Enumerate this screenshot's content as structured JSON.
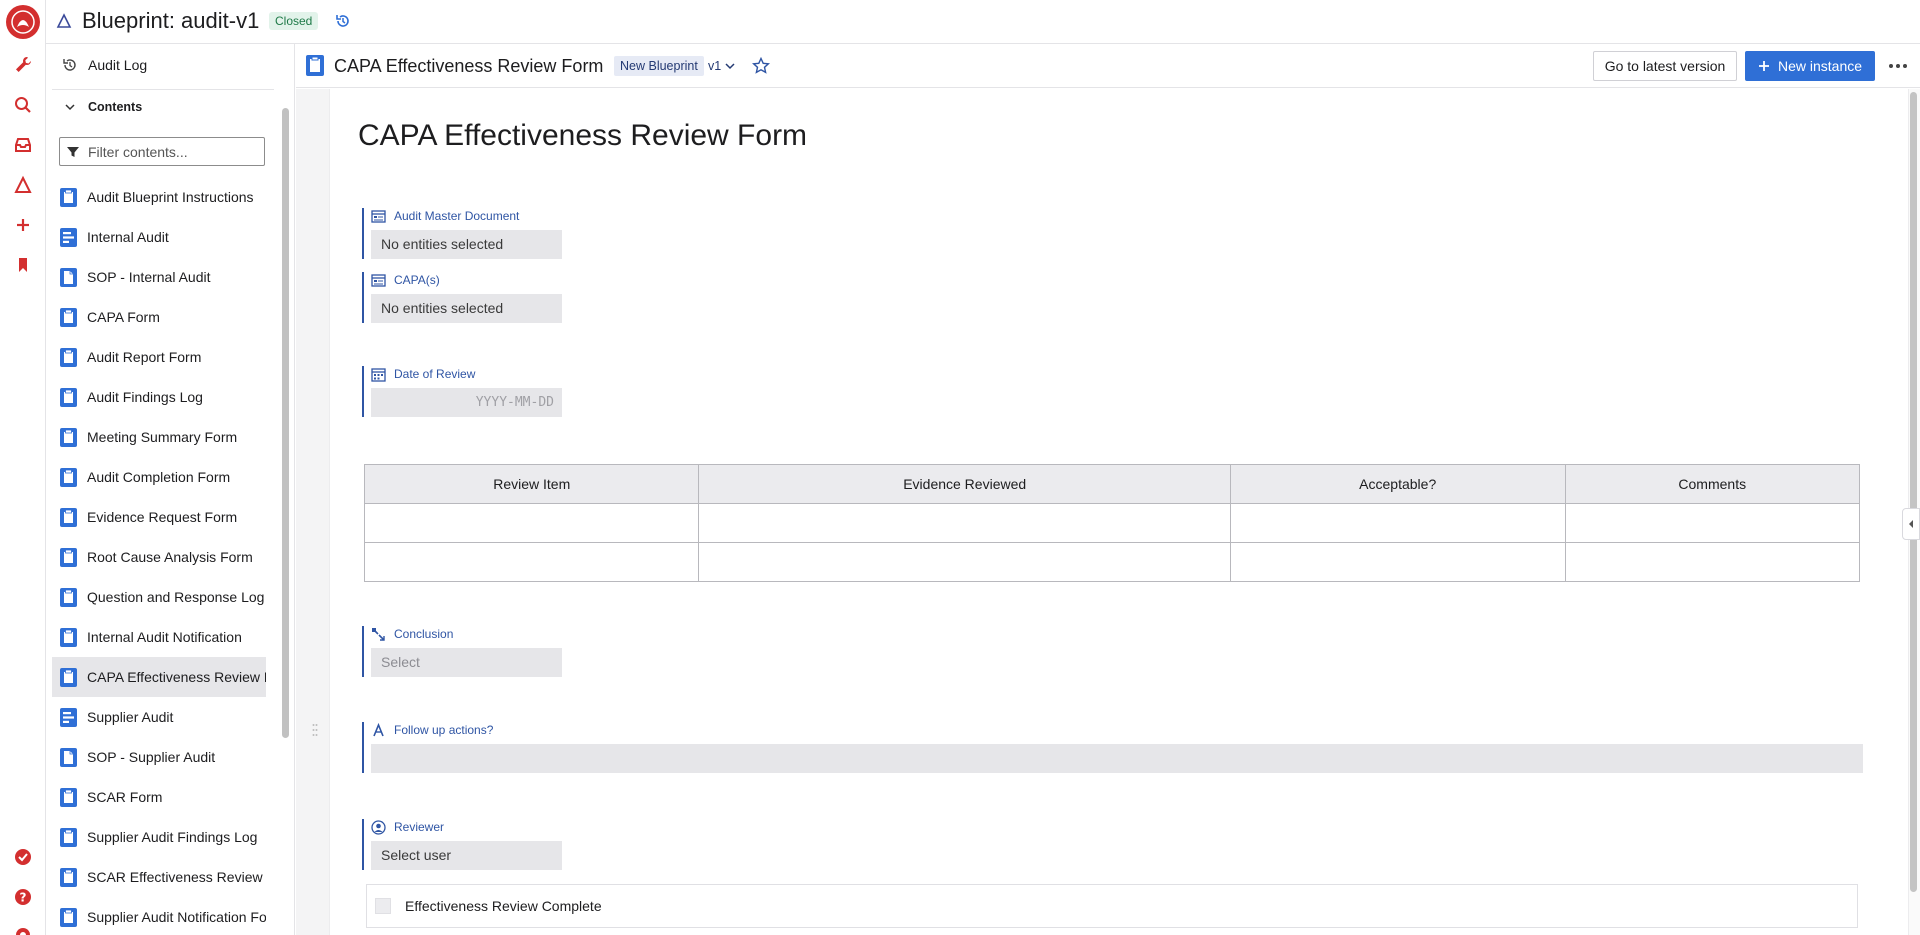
{
  "app": {
    "title": "Blueprint: audit-v1",
    "status": "Closed"
  },
  "sidebar": {
    "audit_log": "Audit Log",
    "contents_label": "Contents",
    "filter_placeholder": "Filter contents...",
    "items": [
      {
        "label": "Audit Blueprint Instructions",
        "icon": "form-icon"
      },
      {
        "label": "Internal Audit",
        "icon": "workflow-icon"
      },
      {
        "label": "SOP - Internal Audit",
        "icon": "document-icon"
      },
      {
        "label": "CAPA Form",
        "icon": "form-icon"
      },
      {
        "label": "Audit Report Form",
        "icon": "form-icon"
      },
      {
        "label": "Audit Findings Log",
        "icon": "form-icon"
      },
      {
        "label": "Meeting Summary Form",
        "icon": "form-icon"
      },
      {
        "label": "Audit Completion Form",
        "icon": "form-icon"
      },
      {
        "label": "Evidence Request Form",
        "icon": "form-icon"
      },
      {
        "label": "Root Cause Analysis Form",
        "icon": "form-icon"
      },
      {
        "label": "Question and Response Log",
        "icon": "form-icon"
      },
      {
        "label": "Internal Audit Notification",
        "icon": "form-icon"
      },
      {
        "label": "CAPA Effectiveness Review Form",
        "icon": "form-icon",
        "active": true
      },
      {
        "label": "Supplier Audit",
        "icon": "workflow-icon"
      },
      {
        "label": "SOP - Supplier Audit",
        "icon": "document-icon"
      },
      {
        "label": "SCAR Form",
        "icon": "form-icon"
      },
      {
        "label": "Supplier Audit Findings Log",
        "icon": "form-icon"
      },
      {
        "label": "SCAR Effectiveness Review",
        "icon": "form-icon"
      },
      {
        "label": "Supplier Audit Notification Form",
        "icon": "form-icon"
      }
    ]
  },
  "header": {
    "doc_title": "CAPA Effectiveness Review Form",
    "blueprint_pill": "New Blueprint",
    "version": "v1",
    "latest_button": "Go to latest version",
    "new_instance_button": "New instance"
  },
  "form": {
    "title": "CAPA Effectiveness Review Form",
    "fields": {
      "audit_master_document": {
        "label": "Audit Master Document",
        "value": "No entities selected"
      },
      "capas": {
        "label": "CAPA(s)",
        "value": "No entities selected"
      },
      "date_of_review": {
        "label": "Date of Review",
        "placeholder": "YYYY-MM-DD"
      },
      "conclusion": {
        "label": "Conclusion",
        "placeholder": "Select"
      },
      "follow_up": {
        "label": "Follow up actions?",
        "value": ""
      },
      "reviewer": {
        "label": "Reviewer",
        "placeholder": "Select user"
      }
    },
    "table": {
      "headers": [
        "Review Item",
        "Evidence Reviewed",
        "Acceptable?",
        "Comments"
      ],
      "rows": [
        [
          "",
          "",
          "",
          ""
        ],
        [
          "",
          "",
          "",
          ""
        ]
      ]
    },
    "checkbox_label": "Effectiveness Review Complete"
  },
  "colors": {
    "accent": "#2f6fd6",
    "brand": "#d32f2f",
    "field_label": "#2f55a4",
    "closed_badge_bg": "#e2f3ea"
  }
}
